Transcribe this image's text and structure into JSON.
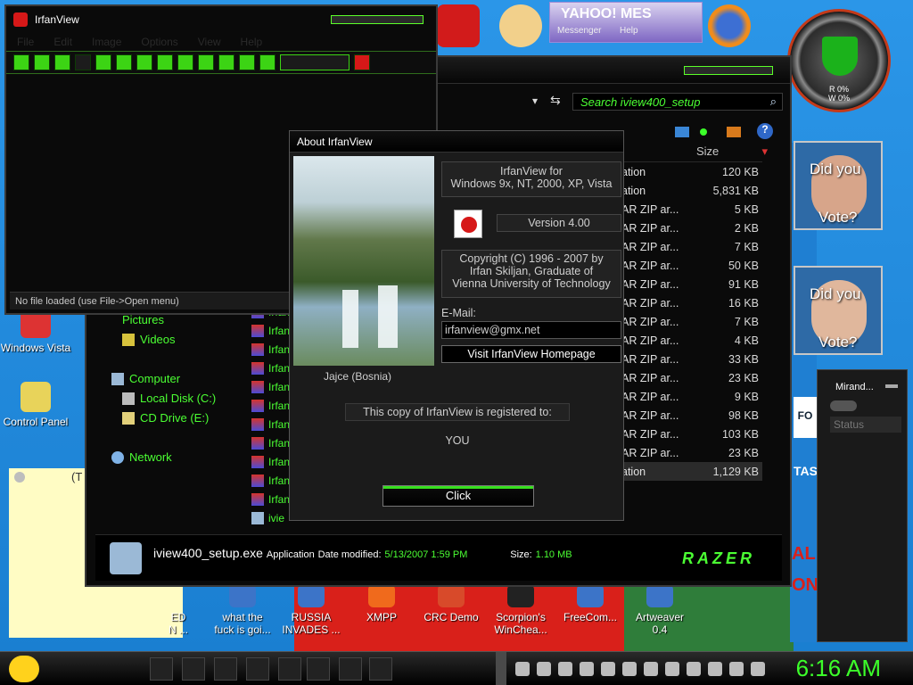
{
  "colors": {
    "accent_green": "#3cff2a",
    "desktop_blue": "#1a86d6",
    "window_bg": "#0a0a0a"
  },
  "desktop": {
    "icons": [
      {
        "label": "Windows Vista",
        "icon": "windows-vista-icon"
      },
      {
        "label": "Control Panel",
        "icon": "control-panel-icon"
      }
    ],
    "top_icons": [
      {
        "label": "DEV C++",
        "icon": "devcpp-icon"
      },
      {
        "label": "Yahoo Messenger",
        "icon": "yahoo-messenger-icon"
      },
      {
        "label": "Firefox",
        "icon": "firefox-icon"
      }
    ],
    "yahoo_text": "YAHOO! MES",
    "yahoo_sub_1": "Messenger",
    "yahoo_sub_2": "Help",
    "bottom_icons": [
      {
        "label_line1": "what the",
        "label_line2": "fuck is goi...",
        "icon": "shortcut-icon"
      },
      {
        "label_line1": "RUSSIA",
        "label_line2": "INVADES ...",
        "icon": "shortcut-icon"
      },
      {
        "label_line1": "XMPP",
        "label_line2": "",
        "icon": "xmpp-icon"
      },
      {
        "label_line1": "CRC Demo",
        "label_line2": "",
        "icon": "crc-demo-icon"
      },
      {
        "label_line1": "Scorpion's",
        "label_line2": "WinChea...",
        "icon": "scorpion-icon"
      },
      {
        "label_line1": "FreeCom...",
        "label_line2": "",
        "icon": "freecom-icon"
      },
      {
        "label_line1": "Artweaver",
        "label_line2": "0.4",
        "icon": "artweaver-icon"
      }
    ],
    "sticky_note_text": "(T",
    "partial_left_text": "ED",
    "partial_left_text2": "N ..."
  },
  "irfan_main": {
    "title": "IrfanView",
    "menu": [
      "File",
      "Edit",
      "Image",
      "Options",
      "View",
      "Help"
    ],
    "status": "No file loaded (use File->Open menu)"
  },
  "explorer": {
    "search_placeholder": "Search iview400_setup",
    "nav": {
      "pictures": "Pictures",
      "videos": "Videos",
      "computer": "Computer",
      "local_disk": "Local Disk (C:)",
      "cd_drive": "CD Drive (E:)",
      "network": "Network"
    },
    "file_prefix": "Irfan",
    "selected_file_prefix": "ivie",
    "size_header": "Size",
    "rows": [
      {
        "type": "ation",
        "size": "120 KB"
      },
      {
        "type": "ation",
        "size": "5,831 KB"
      },
      {
        "type": "AR ZIP ar...",
        "size": "5 KB"
      },
      {
        "type": "AR ZIP ar...",
        "size": "2 KB"
      },
      {
        "type": "AR ZIP ar...",
        "size": "7 KB"
      },
      {
        "type": "AR ZIP ar...",
        "size": "50 KB"
      },
      {
        "type": "AR ZIP ar...",
        "size": "91 KB"
      },
      {
        "type": "AR ZIP ar...",
        "size": "16 KB"
      },
      {
        "type": "AR ZIP ar...",
        "size": "7 KB"
      },
      {
        "type": "AR ZIP ar...",
        "size": "4 KB"
      },
      {
        "type": "AR ZIP ar...",
        "size": "33 KB"
      },
      {
        "type": "AR ZIP ar...",
        "size": "23 KB"
      },
      {
        "type": "AR ZIP ar...",
        "size": "9 KB"
      },
      {
        "type": "AR ZIP ar...",
        "size": "98 KB"
      },
      {
        "type": "AR ZIP ar...",
        "size": "103 KB"
      },
      {
        "type": "AR ZIP ar...",
        "size": "23 KB"
      },
      {
        "type": "ation",
        "size": "1,129 KB"
      }
    ],
    "details": {
      "filename": "iview400_setup.exe",
      "type": "Application",
      "date_label": "Date modified:",
      "date_value": "5/13/2007 1:59 PM",
      "size_label": "Size:",
      "size_value": "1.10 MB",
      "brand": "RAZER"
    }
  },
  "about": {
    "title": "About IrfanView",
    "product_line1": "IrfanView for",
    "product_line2": "Windows 9x, NT, 2000, XP, Vista",
    "version": "Version 4.00",
    "copyright_line1": "Copyright (C) 1996 - 2007 by",
    "copyright_line2": "Irfan Skiljan, Graduate of",
    "copyright_line3": "Vienna University of Technology",
    "photo_caption": "Jajce (Bosnia)",
    "email_label": "E-Mail:",
    "email_value": "irfanview@gmx.net",
    "visit_button": "Visit IrfanView Homepage",
    "registered_text": "This copy of IrfanView is registered to:",
    "registered_to": "YOU",
    "click_button": "Click"
  },
  "widgets": {
    "gauge_r": "R 0%",
    "gauge_w": "W 0%",
    "poster1_line1": "Did you",
    "poster1_line2": "Vote?",
    "poster2_line1": "Did you",
    "poster2_line2": "Vote?",
    "miranda_title": "Mirand...",
    "miranda_status": "Status",
    "partial_fo": "FO",
    "partial_tas": "TAS",
    "partial_al": "AL",
    "partial_on": "ON"
  },
  "taskbar": {
    "clock": "6:16 AM"
  }
}
